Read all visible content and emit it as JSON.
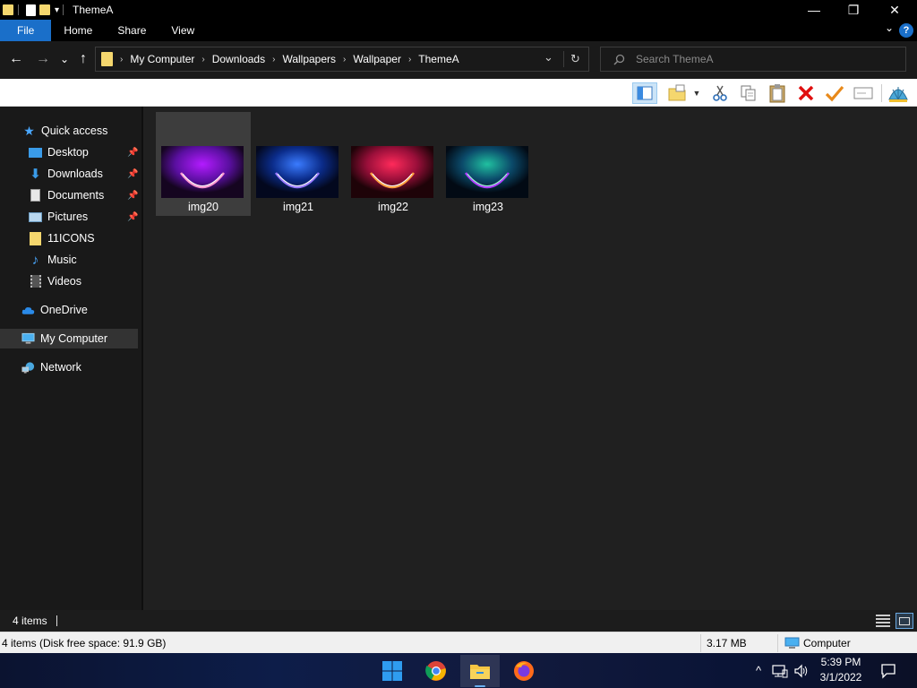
{
  "window": {
    "title": "ThemeA",
    "minimize_glyph": "—",
    "maximize_glyph": "❐",
    "close_glyph": "✕"
  },
  "ribbon": {
    "tabs": [
      "File",
      "Home",
      "Share",
      "View"
    ],
    "help_glyph": "?",
    "collapse_glyph": "⌄"
  },
  "address": {
    "breadcrumbs": [
      "My Computer",
      "Downloads",
      "Wallpapers",
      "Wallpaper",
      "ThemeA"
    ],
    "separator": "›",
    "refresh_glyph": "↻",
    "dropdown_glyph": "⌄"
  },
  "search": {
    "placeholder": "Search ThemeA"
  },
  "nav_glyphs": {
    "back": "←",
    "forward": "→",
    "recent": "⌄",
    "up": "↑"
  },
  "sidebar": {
    "items": [
      {
        "label": "Quick access",
        "icon": "star-icon",
        "pinned": false
      },
      {
        "label": "Desktop",
        "icon": "desktop-icon",
        "pinned": true
      },
      {
        "label": "Downloads",
        "icon": "download-icon",
        "pinned": true
      },
      {
        "label": "Documents",
        "icon": "document-icon",
        "pinned": true
      },
      {
        "label": "Pictures",
        "icon": "pictures-icon",
        "pinned": true
      },
      {
        "label": "11ICONS",
        "icon": "folder-icon",
        "pinned": false
      },
      {
        "label": "Music",
        "icon": "music-icon",
        "pinned": false
      },
      {
        "label": "Videos",
        "icon": "videos-icon",
        "pinned": false
      },
      {
        "label": "OneDrive",
        "icon": "cloud-icon",
        "pinned": false
      },
      {
        "label": "My Computer",
        "icon": "computer-icon",
        "pinned": false,
        "selected": true
      },
      {
        "label": "Network",
        "icon": "network-icon",
        "pinned": false
      }
    ]
  },
  "files": [
    {
      "name": "img20",
      "selected": true,
      "glow": "#e040ff",
      "base": "#5a0fa0"
    },
    {
      "name": "img21",
      "selected": false,
      "glow": "#3a7bff",
      "base": "#0b2c8a"
    },
    {
      "name": "img22",
      "selected": false,
      "glow": "#ff5a3a",
      "base": "#9a0f3a"
    },
    {
      "name": "img23",
      "selected": false,
      "glow": "#34e0a0",
      "base": "#0b4a6a"
    }
  ],
  "status": {
    "item_count": "4 items"
  },
  "details": {
    "summary": "4 items (Disk free space: 91.9 GB)",
    "size": "3.17 MB",
    "location": "Computer"
  },
  "taskbar": {
    "apps": [
      "start-icon",
      "chrome-icon",
      "file-explorer-icon",
      "firefox-icon"
    ],
    "tray_chevron": "^",
    "time": "5:39 PM",
    "date": "3/1/2022"
  },
  "colors": {
    "accent": "#1a6fc9",
    "folder": "#f5d76e",
    "content_bg": "#202020",
    "sidebar_bg": "#191919"
  }
}
